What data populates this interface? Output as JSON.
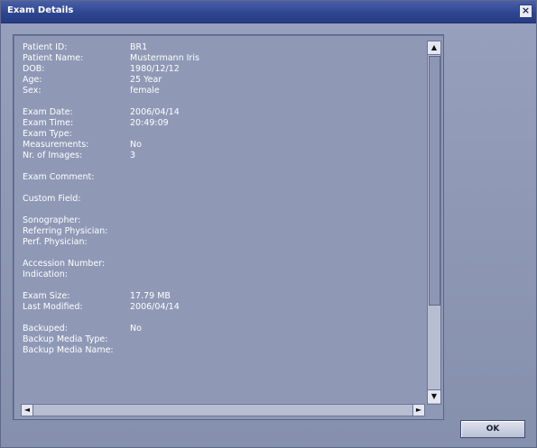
{
  "window": {
    "title": "Exam Details",
    "close_symbol": "×"
  },
  "fields": {
    "patient_id": {
      "label": "Patient ID:",
      "value": "BR1"
    },
    "patient_name": {
      "label": "Patient Name:",
      "value": "Mustermann Iris"
    },
    "dob": {
      "label": "DOB:",
      "value": "1980/12/12"
    },
    "age": {
      "label": "Age:",
      "value": "25 Year"
    },
    "sex": {
      "label": "Sex:",
      "value": "female"
    },
    "exam_date": {
      "label": "Exam Date:",
      "value": "2006/04/14"
    },
    "exam_time": {
      "label": "Exam Time:",
      "value": "20:49:09"
    },
    "exam_type": {
      "label": "Exam Type:",
      "value": ""
    },
    "measurements": {
      "label": "Measurements:",
      "value": "No"
    },
    "nr_images": {
      "label": "Nr. of Images:",
      "value": "3"
    },
    "exam_comment": {
      "label": "Exam Comment:",
      "value": ""
    },
    "custom_field": {
      "label": "Custom Field:",
      "value": ""
    },
    "sonographer": {
      "label": "Sonographer:",
      "value": ""
    },
    "referring_physician": {
      "label": "Referring Physician:",
      "value": ""
    },
    "perf_physician": {
      "label": "Perf. Physician:",
      "value": ""
    },
    "accession_number": {
      "label": "Accession Number:",
      "value": ""
    },
    "indication": {
      "label": "Indication:",
      "value": ""
    },
    "exam_size": {
      "label": "Exam Size:",
      "value": "17.79 MB"
    },
    "last_modified": {
      "label": "Last Modified:",
      "value": "2006/04/14"
    },
    "backuped": {
      "label": "Backuped:",
      "value": "No"
    },
    "backup_media_type": {
      "label": "Backup Media Type:",
      "value": ""
    },
    "backup_media_name": {
      "label": "Backup Media Name:",
      "value": ""
    }
  },
  "buttons": {
    "ok": "OK"
  },
  "icons": {
    "scroll_up": "▲",
    "scroll_down": "▼",
    "scroll_left": "◄",
    "scroll_right": "►"
  }
}
